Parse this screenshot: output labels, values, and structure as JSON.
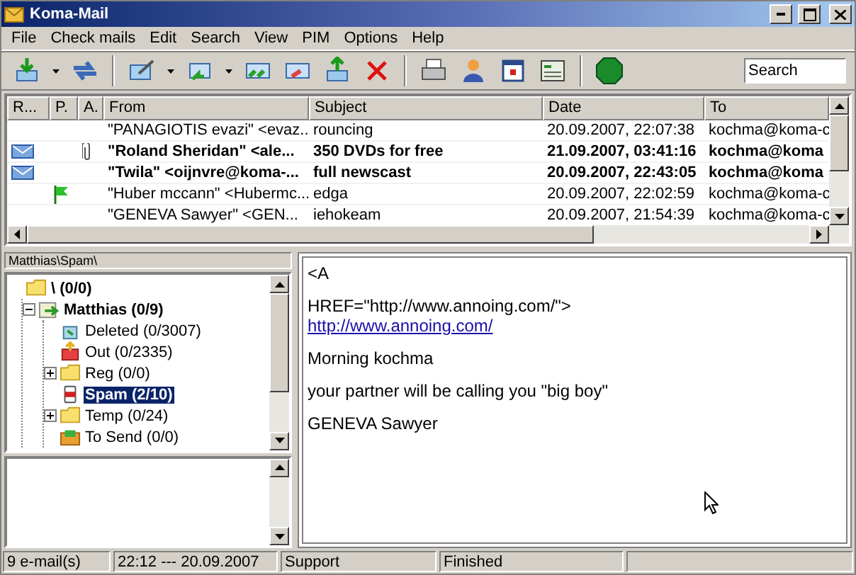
{
  "window": {
    "title": "Koma-Mail"
  },
  "menu": [
    "File",
    "Check mails",
    "Edit",
    "Search",
    "View",
    "PIM",
    "Options",
    "Help"
  ],
  "search": {
    "value": "Search"
  },
  "message_list": {
    "columns": [
      "R...",
      "P.",
      "A.",
      "From",
      "Subject",
      "Date",
      "To"
    ],
    "rows": [
      {
        "unread": false,
        "flagged": false,
        "attachment": false,
        "from": "\"PANAGIOTIS evazi\" <evaz...",
        "subject": "rouncing",
        "date": "20.09.2007, 22:07:38",
        "to": "kochma@koma-c"
      },
      {
        "unread": true,
        "flagged": false,
        "attachment": true,
        "from": "\"Roland Sheridan\" <ale...",
        "subject": "350 DVDs for free",
        "date": "21.09.2007, 03:41:16",
        "to": "kochma@koma"
      },
      {
        "unread": true,
        "flagged": false,
        "attachment": false,
        "from": "\"Twila\" <oijnvre@koma-...",
        "subject": "full newscast",
        "date": "20.09.2007, 22:43:05",
        "to": "kochma@koma"
      },
      {
        "unread": false,
        "flagged": true,
        "attachment": false,
        "from": "\"Huber mccann\" <Hubermc...",
        "subject": "edga",
        "date": "20.09.2007, 22:02:59",
        "to": "kochma@koma-c"
      },
      {
        "unread": false,
        "flagged": false,
        "attachment": false,
        "from": "\"GENEVA Sawyer\" <GEN...",
        "subject": "iehokeam",
        "date": "20.09.2007, 21:54:39",
        "to": "kochma@koma-c"
      }
    ]
  },
  "folder_path": "Matthias\\Spam\\",
  "folders": [
    {
      "label": "\\ (0/0)",
      "kind": "folder",
      "bold": true,
      "selected": false,
      "children": [
        {
          "label": "Matthias (0/9)",
          "kind": "account",
          "bold": true,
          "selected": false,
          "expanded": true,
          "children": [
            {
              "label": "Deleted (0/3007)",
              "kind": "trash",
              "bold": false,
              "selected": false
            },
            {
              "label": "Out (0/2335)",
              "kind": "outbox",
              "bold": false,
              "selected": false
            },
            {
              "label": "Reg (0/0)",
              "kind": "folder",
              "bold": false,
              "selected": false,
              "expanded": false
            },
            {
              "label": "Spam (2/10)",
              "kind": "spam",
              "bold": true,
              "selected": true
            },
            {
              "label": "Temp (0/24)",
              "kind": "folder",
              "bold": false,
              "selected": false,
              "expanded": false
            },
            {
              "label": "To Send (0/0)",
              "kind": "send",
              "bold": false,
              "selected": false
            }
          ]
        }
      ]
    }
  ],
  "preview": [
    {
      "lines": [
        {
          "kind": "text",
          "text": "<A"
        }
      ]
    },
    {
      "lines": [
        {
          "kind": "text",
          "text": "HREF=\"http://www.annoing.com/\">"
        },
        {
          "kind": "link",
          "text": "http://www.annoing.com/"
        }
      ]
    },
    {
      "lines": [
        {
          "kind": "text",
          "text": "Morning kochma"
        }
      ]
    },
    {
      "lines": [
        {
          "kind": "text",
          "text": "your partner will be calling you \"big boy\""
        }
      ]
    },
    {
      "lines": [
        {
          "kind": "text",
          "text": "GENEVA Sawyer"
        }
      ]
    }
  ],
  "status_bar": [
    "9 e-mail(s)",
    "22:12 --- 20.09.2007",
    "Support",
    "Finished"
  ]
}
